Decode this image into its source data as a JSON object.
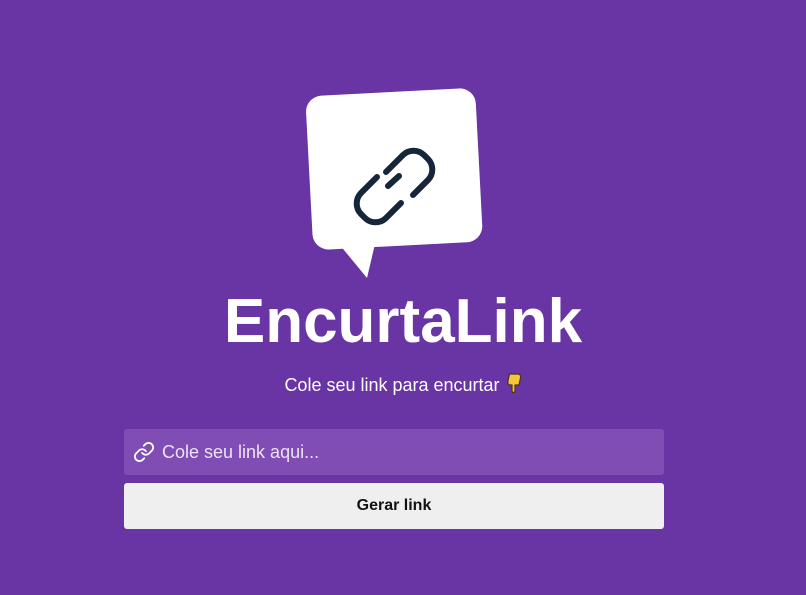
{
  "app": {
    "title": "EncurtaLink",
    "subtitle": "Cole seu link para encurtar"
  },
  "form": {
    "input_placeholder": "Cole seu link aqui...",
    "input_value": "",
    "button_label": "Gerar link"
  },
  "icons": {
    "logo": "chain-link-speech-bubble-icon",
    "subtitle_emoji": "pointing-down-hand-icon",
    "input_icon": "link-icon"
  },
  "colors": {
    "background": "#6934a3",
    "input_background": "#7f4db3",
    "button_background": "#f0eff0",
    "logo_bubble": "#ffffff",
    "logo_chain": "#15263b"
  }
}
